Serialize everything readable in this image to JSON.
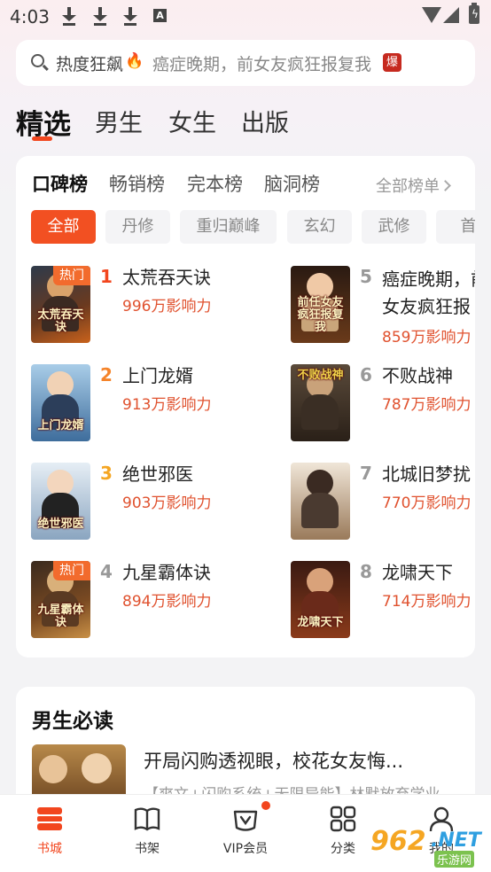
{
  "status": {
    "time": "4:03"
  },
  "search": {
    "hot_label": "热度狂飙",
    "query": "癌症晚期，前女友疯狂报复我",
    "badge": "爆"
  },
  "main_tabs": [
    "精选",
    "男生",
    "女生",
    "出版"
  ],
  "rank_tabs": [
    "口碑榜",
    "畅销榜",
    "完本榜",
    "脑洞榜"
  ],
  "all_rank_label": "全部榜单",
  "chips": [
    "全部",
    "丹修",
    "重归巅峰",
    "玄幻",
    "武修",
    "首"
  ],
  "books": [
    {
      "rank": "1",
      "title": "太荒吞天诀",
      "influence": "996万影响力",
      "tag": "热门",
      "cover_text": "太荒吞天诀",
      "rank_color": "#f2461e"
    },
    {
      "rank": "2",
      "title": "上门龙婿",
      "influence": "913万影响力",
      "tag": "",
      "cover_text": "上门龙婿",
      "rank_color": "#f5842a"
    },
    {
      "rank": "3",
      "title": "绝世邪医",
      "influence": "903万影响力",
      "tag": "",
      "cover_text": "绝世邪医",
      "rank_color": "#f5a623"
    },
    {
      "rank": "4",
      "title": "九星霸体诀",
      "influence": "894万影响力",
      "tag": "热门",
      "cover_text": "九星霸体诀",
      "rank_color": "#999999"
    },
    {
      "rank": "5",
      "title": "癌症晚期，前\n女友疯狂报",
      "influence": "859万影响力",
      "tag": "",
      "cover_text": "前任女友疯狂报复我",
      "rank_color": "#999999"
    },
    {
      "rank": "6",
      "title": "不败战神",
      "influence": "787万影响力",
      "tag": "",
      "cover_text": "不败战神",
      "rank_color": "#999999"
    },
    {
      "rank": "7",
      "title": "北城旧梦扰",
      "influence": "770万影响力",
      "tag": "",
      "cover_text": "",
      "rank_color": "#999999"
    },
    {
      "rank": "8",
      "title": "龙啸天下",
      "influence": "714万影响力",
      "tag": "",
      "cover_text": "龙啸天下",
      "rank_color": "#999999"
    }
  ],
  "section2": {
    "title": "男生必读",
    "featured_title": "开局闪购透视眼，校花女友悔...",
    "featured_desc": "【爽文+闪购系统+无限异能】林默放弃学业"
  },
  "bottom_nav": [
    "书城",
    "书架",
    "VIP会员",
    "分类",
    "我的"
  ],
  "watermark": {
    "main": "962",
    "net": ".NET",
    "sub": "乐游网"
  },
  "colors": {
    "accent": "#f2461e",
    "influence": "#e0522f"
  }
}
